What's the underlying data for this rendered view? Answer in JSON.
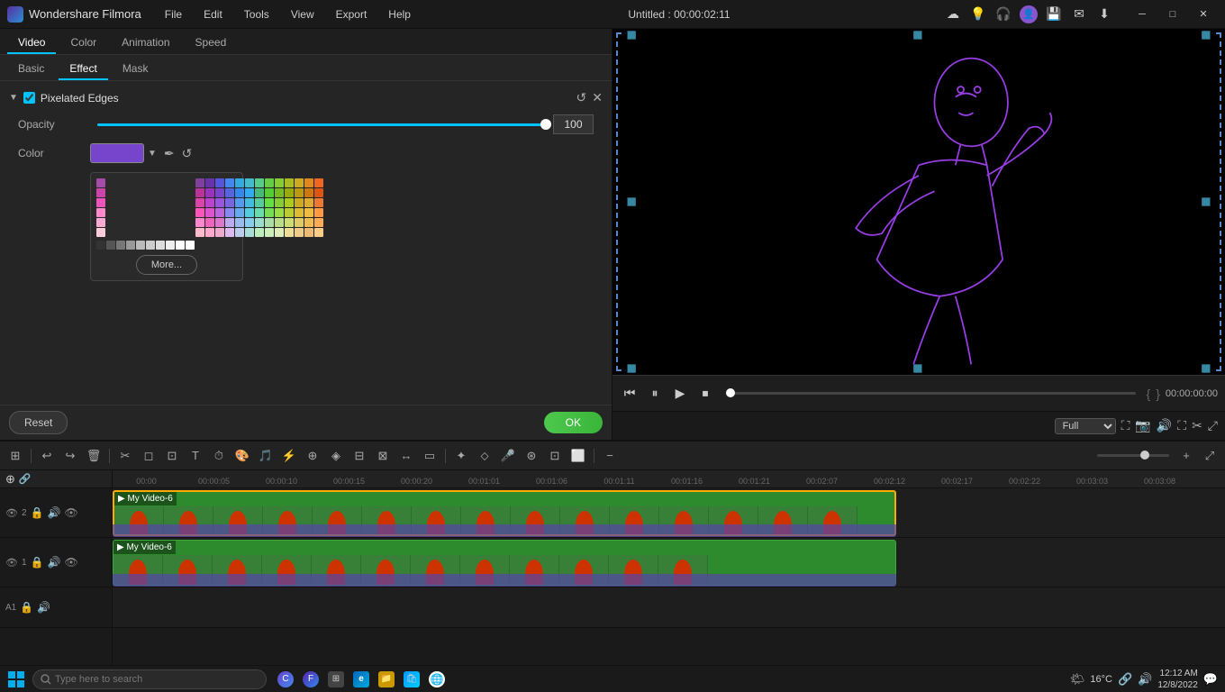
{
  "titlebar": {
    "app_name": "Wondershare Filmora",
    "title": "Untitled : 00:00:02:11",
    "menu_items": [
      "File",
      "Edit",
      "Tools",
      "View",
      "Export",
      "Help"
    ],
    "win_min": "─",
    "win_max": "□",
    "win_close": "✕"
  },
  "prop_tabs": {
    "tabs": [
      "Video",
      "Color",
      "Animation",
      "Speed"
    ],
    "active": "Video"
  },
  "sub_tabs": {
    "tabs": [
      "Basic",
      "Effect",
      "Mask"
    ],
    "active": "Effect"
  },
  "effect": {
    "name": "Pixelated Edges",
    "enabled": true,
    "opacity_label": "Opacity",
    "opacity_value": "100",
    "color_label": "Color",
    "color_hex": "#7744cc",
    "more_label": "More...",
    "reset_label": "Reset",
    "ok_label": "OK"
  },
  "preview": {
    "timecode": "00:00:00:00",
    "quality": "Full",
    "bracket_open": "{",
    "bracket_close": "}"
  },
  "timeline": {
    "tracks": [
      {
        "id": "v2",
        "label": "My Video-6",
        "type": "video"
      },
      {
        "id": "v1",
        "label": "My Video-6",
        "type": "video"
      },
      {
        "id": "a1",
        "label": "",
        "type": "audio"
      }
    ],
    "ruler_times": [
      "00:00",
      "00:00:05",
      "00:00:10",
      "00:00:15",
      "00:00:20",
      "00:01:01",
      "00:01:06",
      "00:01:11",
      "00:01:16",
      "00:01:21",
      "00:02:07",
      "00:02:12",
      "00:02:17",
      "00:02:22",
      "00:03:03",
      "00:03:08"
    ]
  },
  "taskbar": {
    "search_placeholder": "Type here to search",
    "time": "12:12 AM",
    "date": "12/8/2022",
    "weather": "16°C"
  },
  "palette_colors": [
    [
      "#a64ca6",
      "#8040a0",
      "#6633aa",
      "#5555dd",
      "#4488ee",
      "#33aadd",
      "#44bbcc",
      "#55cc88",
      "#66cc44",
      "#88cc33",
      "#aabb22",
      "#ccaa22",
      "#dd8822",
      "#ee6622"
    ],
    [
      "#cc44aa",
      "#bb3399",
      "#9933bb",
      "#7744cc",
      "#5566dd",
      "#3388ee",
      "#33aaee",
      "#44bb77",
      "#55cc33",
      "#77bb22",
      "#99aa11",
      "#bb9911",
      "#cc7711",
      "#dd5511"
    ],
    [
      "#ee55bb",
      "#dd44aa",
      "#bb44cc",
      "#9955dd",
      "#7766dd",
      "#5599ee",
      "#44bbdd",
      "#55cc99",
      "#66dd44",
      "#88cc33",
      "#aacc22",
      "#ccaa22",
      "#ddaa33",
      "#ee7733"
    ],
    [
      "#ff88cc",
      "#ff55bb",
      "#dd55cc",
      "#bb66dd",
      "#8888ee",
      "#66aaee",
      "#55ccdd",
      "#66ddaa",
      "#77dd55",
      "#99dd44",
      "#bbcc33",
      "#ddbb33",
      "#eebb44",
      "#ff9944"
    ],
    [
      "#ffaad4",
      "#ff88cc",
      "#ee66bb",
      "#dd77cc",
      "#bbaaee",
      "#99bbee",
      "#88ccee",
      "#99ddcc",
      "#aadda8",
      "#bbdd88",
      "#ccdd77",
      "#ddcc66",
      "#eebb55",
      "#ffaa55"
    ],
    [
      "#ffccdd",
      "#ffbbcc",
      "#ffaacc",
      "#eeaacc",
      "#ddbbee",
      "#bbccee",
      "#aaddd8",
      "#bbeebb",
      "#cceebb",
      "#ddeebb",
      "#eedd99",
      "#eecc88",
      "#eebb77",
      "#ffcc88"
    ],
    [
      "#333333",
      "#555555",
      "#777777",
      "#999999",
      "#bbbbbb",
      "#cccccc",
      "#dddddd",
      "#eeeeee",
      "#ffffff",
      "#ffffff"
    ]
  ]
}
